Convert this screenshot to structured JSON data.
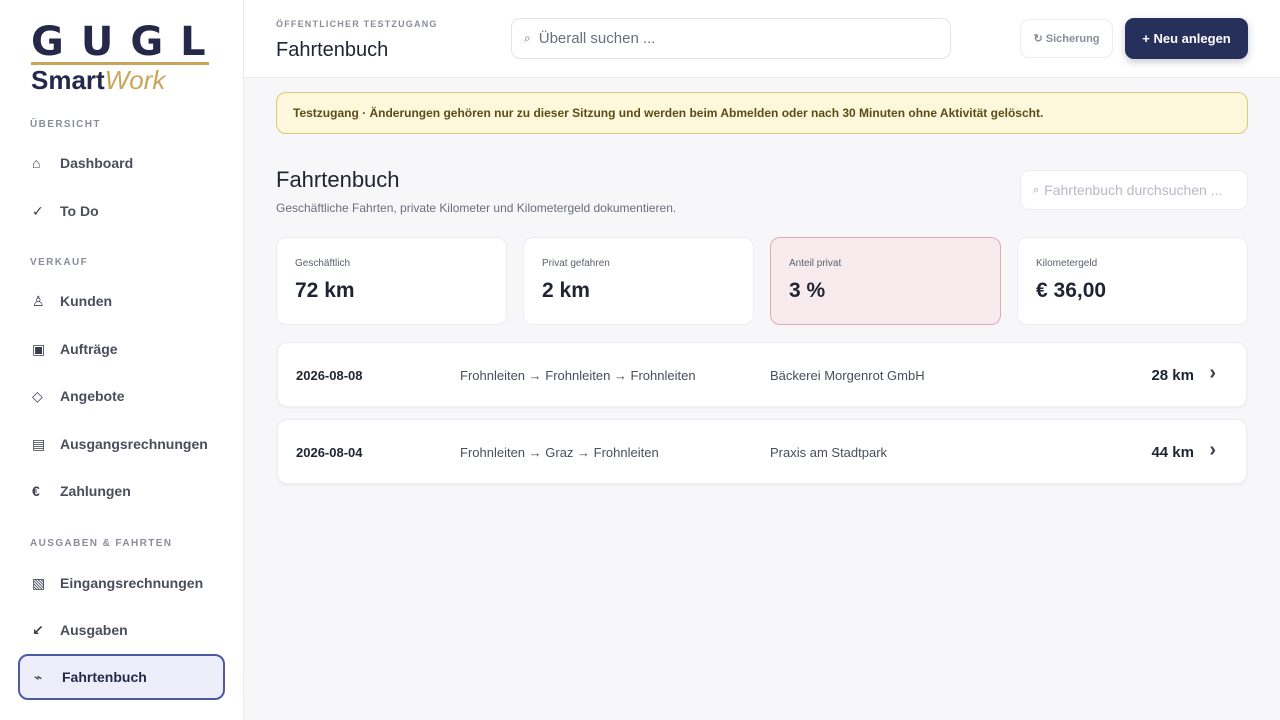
{
  "brand": {
    "logo_top": "GUGL",
    "logo_smart": "Smart",
    "logo_work": "Work"
  },
  "sidebar": {
    "sections": [
      {
        "title": "ÜBERSICHT"
      },
      {
        "title": "VERKAUF"
      },
      {
        "title": "AUSGABEN & FAHRTEN"
      }
    ],
    "items": [
      {
        "label": "Dashboard",
        "icon": "⌂"
      },
      {
        "label": "To Do",
        "icon": "✓"
      },
      {
        "label": "Kunden",
        "icon": "♙"
      },
      {
        "label": "Aufträge",
        "icon": "▣"
      },
      {
        "label": "Angebote",
        "icon": "◇"
      },
      {
        "label": "Ausgangsrechnungen",
        "icon": "▤"
      },
      {
        "label": "Zahlungen",
        "icon": "€"
      },
      {
        "label": "Eingangsrechnungen",
        "icon": "▧"
      },
      {
        "label": "Ausgaben",
        "icon": "↙"
      },
      {
        "label": "Fahrtenbuch",
        "icon": "⌁",
        "active": true
      }
    ]
  },
  "header": {
    "kicker": "ÖFFENTLICHER TESTZUGANG",
    "title": "Fahrtenbuch",
    "search_placeholder": "Überall suchen ...",
    "search_icon": "⌕",
    "backup_label": "↻ Sicherung",
    "new_label": "+ Neu anlegen"
  },
  "banner": {
    "text": "Testzugang · Änderungen gehören nur zu dieser Sitzung und werden beim Abmelden oder nach 30 Minuten ohne Aktivität gelöscht."
  },
  "page": {
    "title": "Fahrtenbuch",
    "subtitle": "Geschäftliche Fahrten, private Kilometer und Kilometergeld dokumentieren.",
    "search_placeholder": "Fahrtenbuch durchsuchen ...",
    "search_icon": "⌕"
  },
  "stats": [
    {
      "label": "Geschäftlich",
      "value": "72 km"
    },
    {
      "label": "Privat gefahren",
      "value": "2 km"
    },
    {
      "label": "Anteil privat",
      "value": "3 %",
      "highlight": true
    },
    {
      "label": "Kilometergeld",
      "value": "€ 36,00"
    }
  ],
  "trips": [
    {
      "date": "2026-08-08",
      "route": "Frohnleiten → Frohnleiten → Frohnleiten",
      "customer": "Bäckerei Morgenrot GmbH",
      "km": "28 km"
    },
    {
      "date": "2026-08-04",
      "route": "Frohnleiten → Graz → Frohnleiten",
      "customer": "Praxis am Stadtpark",
      "km": "44 km"
    }
  ],
  "colors": {
    "primary": "#27305a",
    "accent": "#c9a659",
    "banner_bg": "#fdf7dc",
    "highlight_bg": "#f8ebee",
    "active_border": "#4d5aa0"
  }
}
